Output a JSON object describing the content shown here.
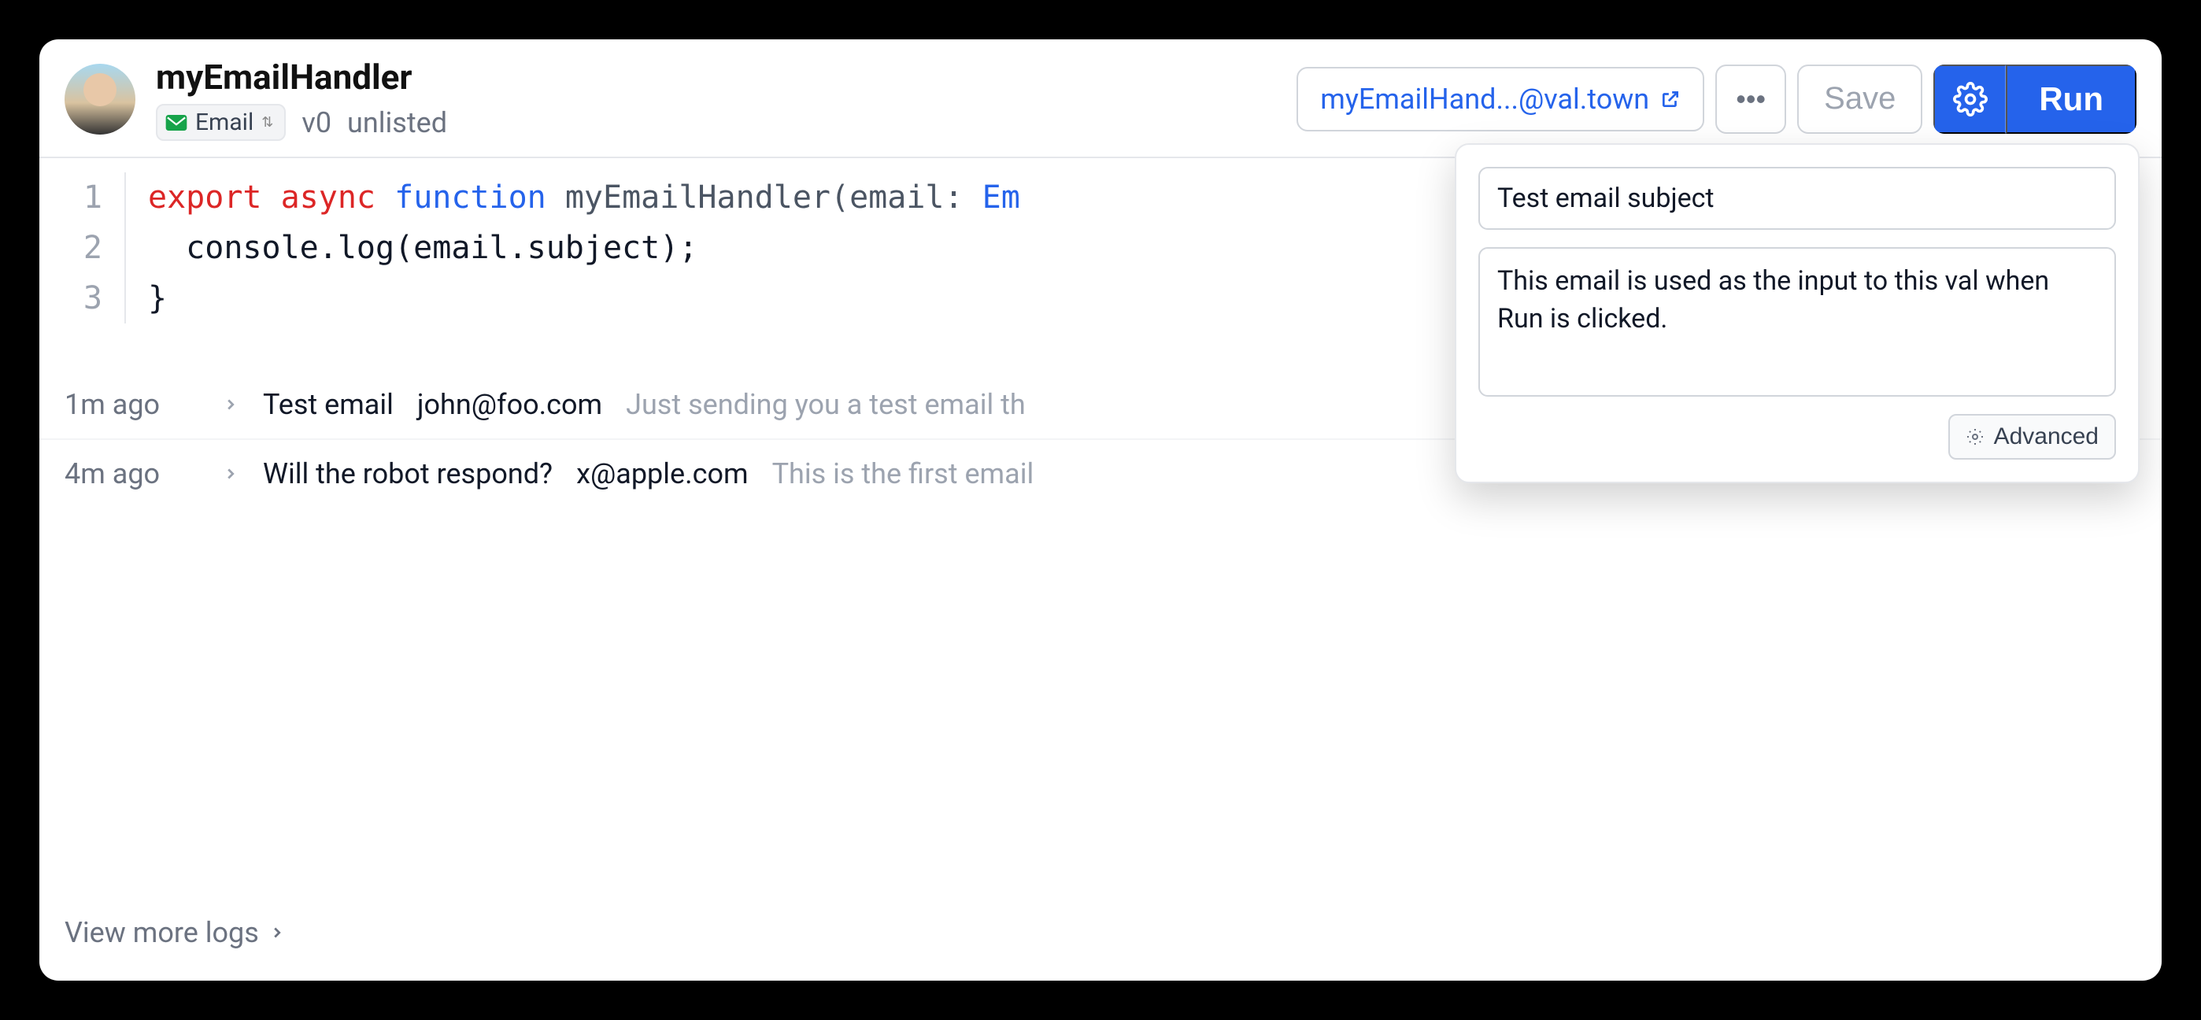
{
  "header": {
    "title": "myEmailHandler",
    "badge_label": "Email",
    "version": "v0",
    "visibility": "unlisted",
    "email_address": "myEmailHand...@val.town",
    "save_label": "Save",
    "run_label": "Run"
  },
  "code": {
    "lines": [
      "1",
      "2",
      "3"
    ],
    "line1_export": "export",
    "line1_async": "async",
    "line1_function": "function",
    "line1_name": " myEmailHandler(email: ",
    "line1_type": "Em",
    "line2": "  console.log(email.subject);",
    "line3": "}"
  },
  "popover": {
    "subject_value": "Test email subject",
    "body_value": "This email is used as the input to this val when Run is clicked.",
    "advanced_label": "Advanced"
  },
  "logs": [
    {
      "time": "1m ago",
      "subject": "Test email",
      "from": "john@foo.com",
      "preview": "Just sending you a test email th"
    },
    {
      "time": "4m ago",
      "subject": "Will the robot respond?",
      "from": "x@apple.com",
      "preview": "This is the first email"
    }
  ],
  "view_more": "View more logs"
}
